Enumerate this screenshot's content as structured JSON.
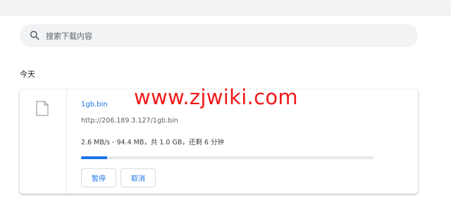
{
  "search": {
    "placeholder": "搜索下载内容",
    "icon": "search-icon"
  },
  "section": {
    "heading": "今天"
  },
  "download": {
    "file_icon": "file-icon",
    "file_name": "1gb.bin",
    "url": "http://206.189.3.127/1gb.bin",
    "status": "2.6 MB/s - 94.4 MB，共 1.0 GB，还剩 6 分钟",
    "progress_fraction": 0.09,
    "pause_label": "暂停",
    "cancel_label": "取消"
  },
  "watermark": "www.zjwiki.com",
  "colors": {
    "accent": "#1a73e8",
    "watermark": "#f01818",
    "search_bg": "#f1f3f4"
  }
}
